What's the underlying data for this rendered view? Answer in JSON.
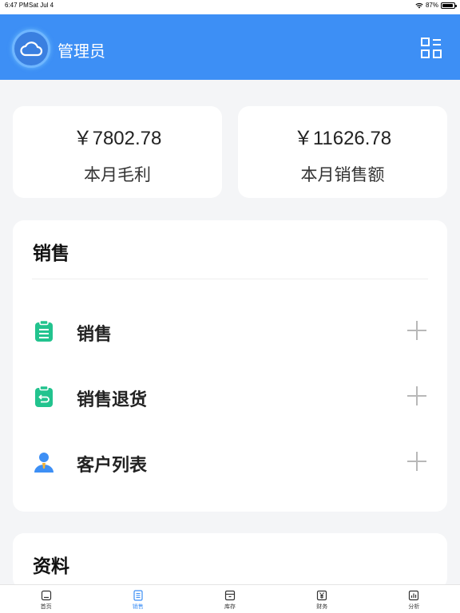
{
  "status_bar": {
    "time": "6:47 PM",
    "date": "Sat Jul 4",
    "battery": "87%",
    "battery_level": 0.87
  },
  "header": {
    "title": "管理员",
    "accent_color": "#3d8ff5"
  },
  "stats": [
    {
      "value": "￥7802.78",
      "label": "本月毛利"
    },
    {
      "value": "￥11626.78",
      "label": "本月销售额"
    }
  ],
  "sales_section": {
    "title": "销售",
    "items": [
      {
        "label": "销售",
        "icon": "clipboard-icon",
        "icon_color": "#22c38e"
      },
      {
        "label": "销售退货",
        "icon": "clipboard-return-icon",
        "icon_color": "#22c38e"
      },
      {
        "label": "客户列表",
        "icon": "user-icon",
        "icon_color": "#3d8ff5"
      }
    ]
  },
  "data_section": {
    "title": "资料"
  },
  "tabbar": {
    "active_index": 1,
    "tabs": [
      {
        "label": "首页",
        "icon": "home-icon"
      },
      {
        "label": "销售",
        "icon": "document-icon"
      },
      {
        "label": "库存",
        "icon": "box-icon"
      },
      {
        "label": "财务",
        "icon": "yen-icon"
      },
      {
        "label": "分析",
        "icon": "bar-chart-icon"
      }
    ]
  }
}
